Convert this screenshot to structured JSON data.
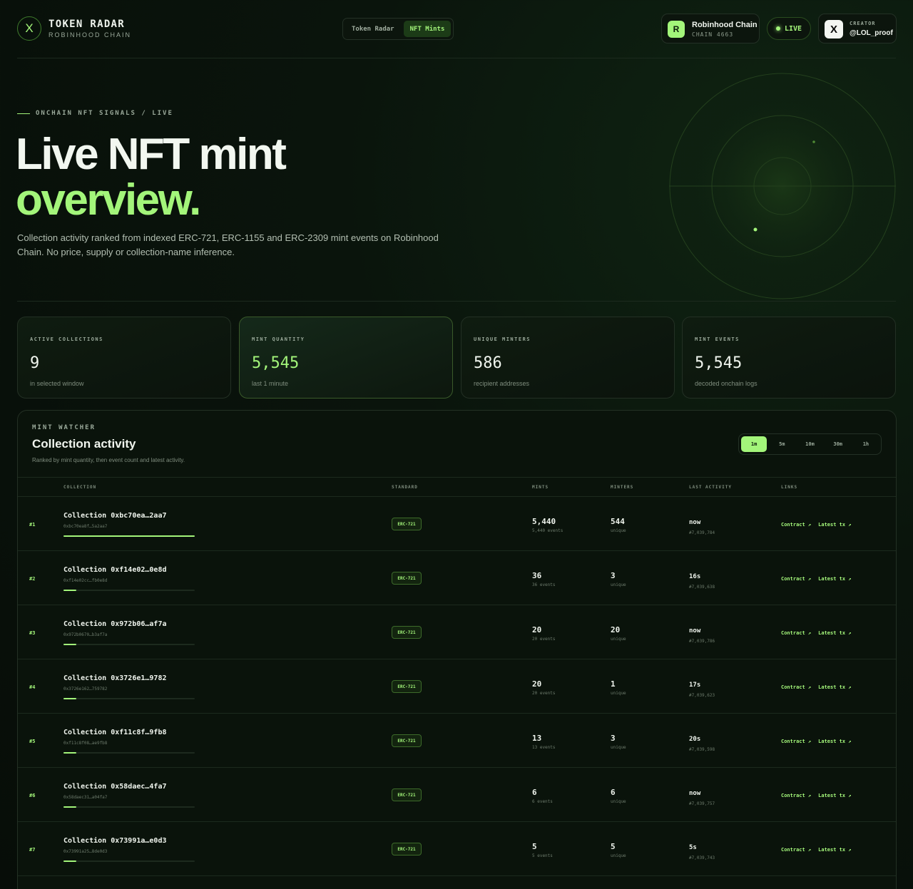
{
  "brand": {
    "logo_glyph": "X",
    "title": "TOKEN RADAR",
    "subtitle": "ROBINHOOD CHAIN"
  },
  "nav_tabs": [
    {
      "label": "Token Radar",
      "active": false
    },
    {
      "label": "NFT Mints",
      "active": true
    }
  ],
  "chain": {
    "badge": "R",
    "name": "Robinhood Chain",
    "id": "CHAIN 4663"
  },
  "live": {
    "label": "LIVE"
  },
  "creator": {
    "badge": "X",
    "label": "CREATOR",
    "handle": "@LOL_proof"
  },
  "hero": {
    "eyebrow": "ONCHAIN NFT SIGNALS / LIVE",
    "title_line1": "Live NFT mint",
    "title_line2": "overview.",
    "description": "Collection activity ranked from indexed ERC-721, ERC-1155 and ERC-2309 mint events on Robinhood Chain. No price, supply or collection-name inference."
  },
  "stats": [
    {
      "label": "ACTIVE COLLECTIONS",
      "value": "9",
      "sub": "in selected window",
      "highlight": false
    },
    {
      "label": "MINT QUANTITY",
      "value": "5,545",
      "sub": "last 1 minute",
      "highlight": true
    },
    {
      "label": "UNIQUE MINTERS",
      "value": "586",
      "sub": "recipient addresses",
      "highlight": false
    },
    {
      "label": "MINT EVENTS",
      "value": "5,545",
      "sub": "decoded onchain logs",
      "highlight": false
    }
  ],
  "panel": {
    "eyebrow": "MINT WATCHER",
    "title": "Collection activity",
    "subtitle": "Ranked by mint quantity, then event count and latest activity.",
    "ranges": [
      {
        "label": "1m",
        "active": true
      },
      {
        "label": "5m",
        "active": false
      },
      {
        "label": "10m",
        "active": false
      },
      {
        "label": "30m",
        "active": false
      },
      {
        "label": "1h",
        "active": false
      }
    ],
    "columns": [
      "COLLECTION",
      "STANDARD",
      "MINTS",
      "MINTERS",
      "LAST ACTIVITY",
      "LINKS"
    ]
  },
  "rows": [
    {
      "rank": "#1",
      "name": "Collection 0xbc70ea…2aa7",
      "addr": "0xbc70ea8f…5a2aa7",
      "standard": "ERC-721",
      "mints": "5,440",
      "events": "5,440 events",
      "minters": "544",
      "unique": "unique",
      "activity": "now",
      "block": "#7,039,784",
      "share": 1.0,
      "contract": "Contract ↗",
      "latest": "Latest tx ↗"
    },
    {
      "rank": "#2",
      "name": "Collection 0xf14e02…0e8d",
      "addr": "0xf14e02cc…fb0e8d",
      "standard": "ERC-721",
      "mints": "36",
      "events": "36 events",
      "minters": "3",
      "unique": "unique",
      "activity": "16s",
      "block": "#7,039,638",
      "share": 0.1,
      "contract": "Contract ↗",
      "latest": "Latest tx ↗"
    },
    {
      "rank": "#3",
      "name": "Collection 0x972b06…af7a",
      "addr": "0x972b0670…b3af7a",
      "standard": "ERC-721",
      "mints": "20",
      "events": "20 events",
      "minters": "20",
      "unique": "unique",
      "activity": "now",
      "block": "#7,039,786",
      "share": 0.1,
      "contract": "Contract ↗",
      "latest": "Latest tx ↗"
    },
    {
      "rank": "#4",
      "name": "Collection 0x3726e1…9782",
      "addr": "0x3726e162…759782",
      "standard": "ERC-721",
      "mints": "20",
      "events": "20 events",
      "minters": "1",
      "unique": "unique",
      "activity": "17s",
      "block": "#7,039,623",
      "share": 0.1,
      "contract": "Contract ↗",
      "latest": "Latest tx ↗"
    },
    {
      "rank": "#5",
      "name": "Collection 0xf11c8f…9fb8",
      "addr": "0xf11c8f08…ae9fb8",
      "standard": "ERC-721",
      "mints": "13",
      "events": "13 events",
      "minters": "3",
      "unique": "unique",
      "activity": "20s",
      "block": "#7,039,598",
      "share": 0.1,
      "contract": "Contract ↗",
      "latest": "Latest tx ↗"
    },
    {
      "rank": "#6",
      "name": "Collection 0x58daec…4fa7",
      "addr": "0x58daec31…a04fa7",
      "standard": "ERC-721",
      "mints": "6",
      "events": "6 events",
      "minters": "6",
      "unique": "unique",
      "activity": "now",
      "block": "#7,039,757",
      "share": 0.1,
      "contract": "Contract ↗",
      "latest": "Latest tx ↗"
    },
    {
      "rank": "#7",
      "name": "Collection 0x73991a…e0d3",
      "addr": "0x73991a25…8de0d3",
      "standard": "ERC-721",
      "mints": "5",
      "events": "5 events",
      "minters": "5",
      "unique": "unique",
      "activity": "5s",
      "block": "#7,039,743",
      "share": 0.1,
      "contract": "Contract ↗",
      "latest": "Latest tx ↗"
    }
  ],
  "colors": {
    "accent": "#a3f57a",
    "background": "#070d08",
    "border": "#1c2a1e"
  }
}
